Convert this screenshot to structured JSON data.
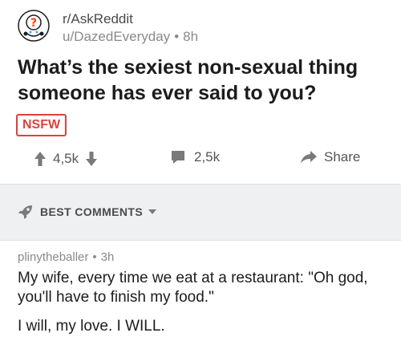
{
  "post": {
    "subreddit": "r/AskReddit",
    "author": "u/DazedEveryday",
    "separator": "•",
    "age": "8h",
    "title": "What’s the sexiest non-sexual thing someone has ever said to you?",
    "badge": "NSFW",
    "votes": "4,5k",
    "comments": "2,5k",
    "share_label": "Share"
  },
  "sort": {
    "label": "BEST COMMENTS"
  },
  "comment": {
    "author": "plinytheballer",
    "separator": "•",
    "age": "3h",
    "body_line1": "My wife, every time we eat at a restaurant: \"Oh god, you'll have to finish my food.\"",
    "body_line2": "I will, my love. I WILL."
  },
  "colors": {
    "nsfw": "#e3403a",
    "sort_bar_bg": "#eef0f2",
    "icon_gray": "#7a7a7a"
  }
}
